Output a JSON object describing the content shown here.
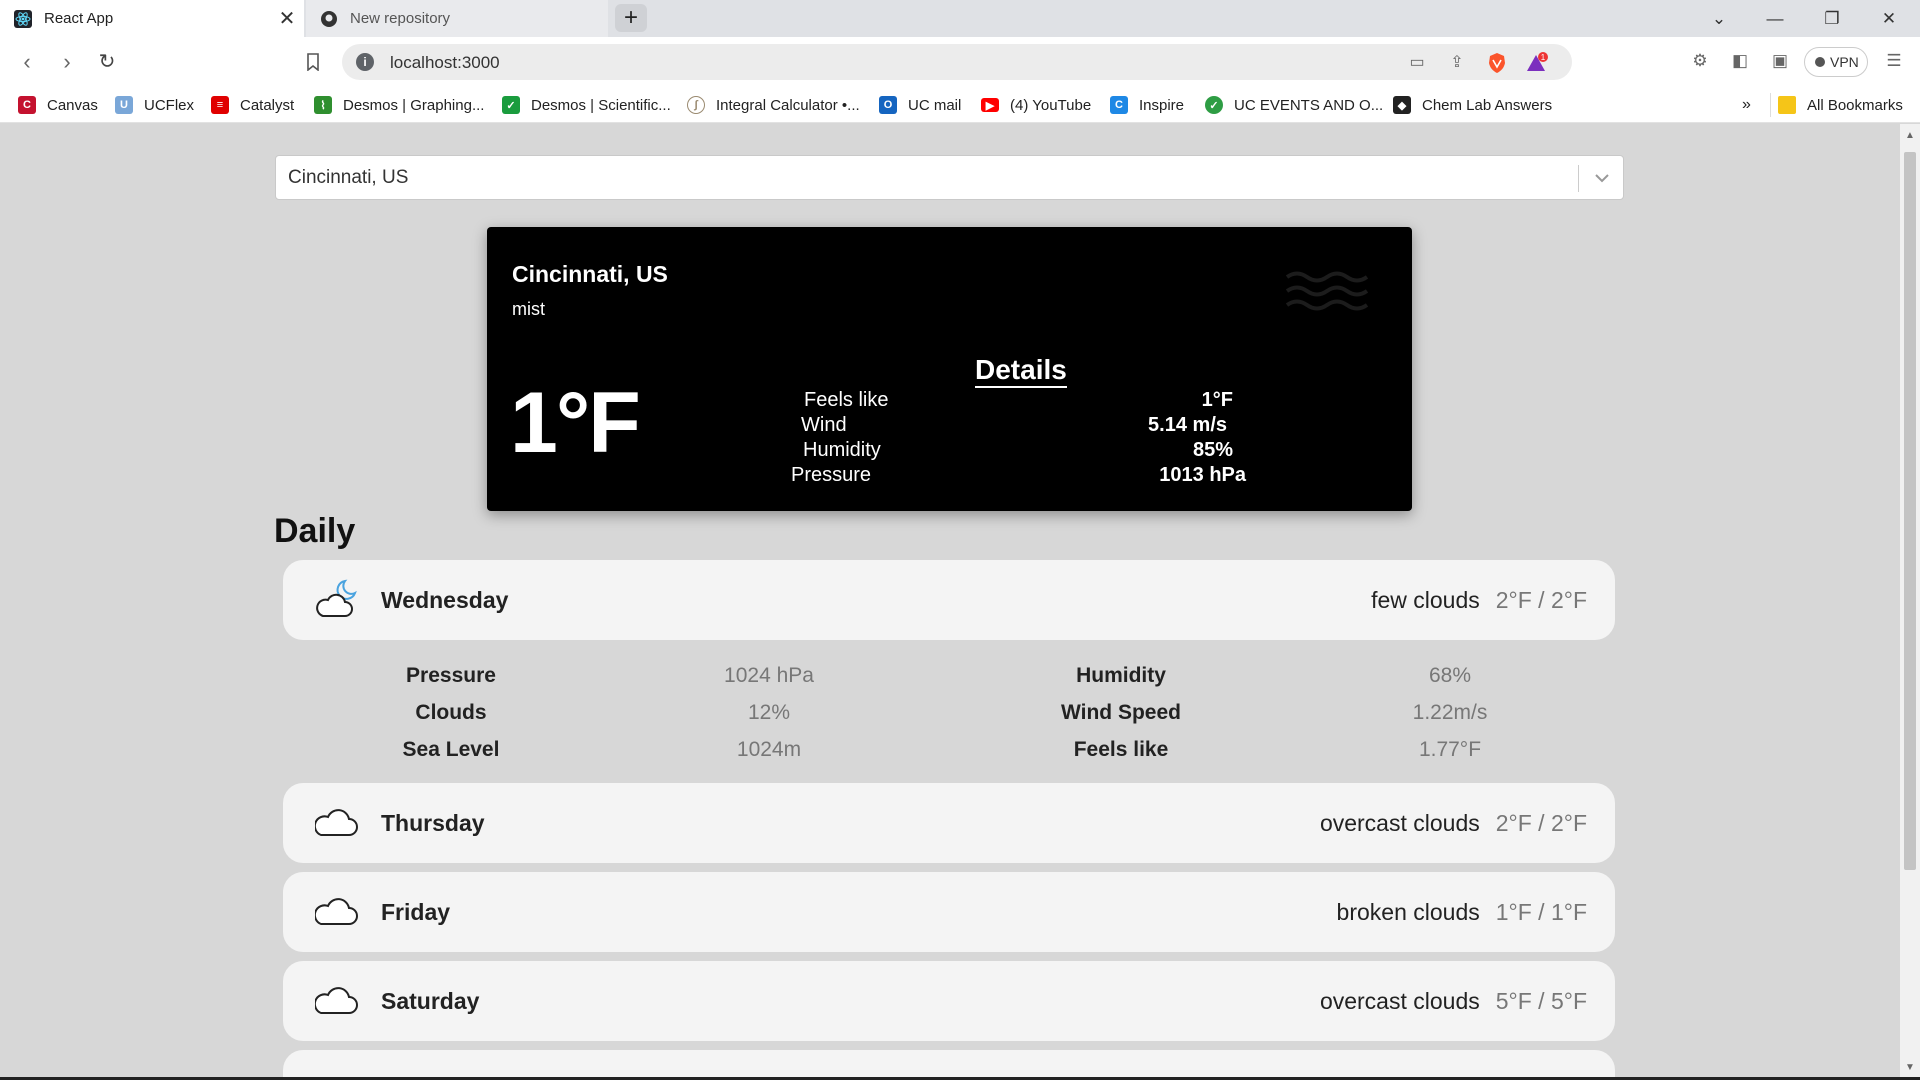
{
  "browser": {
    "tabs": [
      {
        "title": "React App",
        "active": true
      },
      {
        "title": "New repository",
        "active": false
      }
    ],
    "url": "localhost:3000",
    "vpn_label": "VPN",
    "brave_badge_count": "1",
    "bookmarks": [
      {
        "label": "Canvas",
        "color": "#c4122f"
      },
      {
        "label": "UCFlex",
        "color": "#7aa7d8"
      },
      {
        "label": "Catalyst",
        "color": "#e00000"
      },
      {
        "label": "Desmos | Graphing...",
        "color": "#2f8f2f"
      },
      {
        "label": "Desmos | Scientific...",
        "color": "#1a9c3e"
      },
      {
        "label": "Integral Calculator •...",
        "color": "#9a8a70"
      },
      {
        "label": "UC mail",
        "color": "#1565c0"
      },
      {
        "label": "(4) YouTube",
        "color": "#ff0000"
      },
      {
        "label": "Inspire",
        "color": "#1e88e5"
      },
      {
        "label": "UC EVENTS AND O...",
        "color": "#2e9d44"
      },
      {
        "label": "Chem Lab Answers",
        "color": "#222222"
      }
    ],
    "all_bookmarks_label": "All Bookmarks",
    "overflow_label": "»"
  },
  "search": {
    "value": "Cincinnati, US"
  },
  "current": {
    "city": "Cincinnati, US",
    "description": "mist",
    "temperature": "1°F",
    "details_title": "Details",
    "details": [
      {
        "label": "Feels like",
        "value": "1°F"
      },
      {
        "label": "Wind",
        "value": "5.14 m/s"
      },
      {
        "label": "Humidity",
        "value": "85%"
      },
      {
        "label": "Pressure",
        "value": "1013 hPa"
      }
    ]
  },
  "daily_title": "Daily",
  "days": [
    {
      "name": "Wednesday",
      "condition": "few clouds",
      "minmax": "2°F / 2°F",
      "icon": "moon-cloud-icon"
    },
    {
      "name": "Thursday",
      "condition": "overcast clouds",
      "minmax": "2°F / 2°F",
      "icon": "cloud-icon"
    },
    {
      "name": "Friday",
      "condition": "broken clouds",
      "minmax": "1°F / 1°F",
      "icon": "cloud-icon"
    },
    {
      "name": "Saturday",
      "condition": "overcast clouds",
      "minmax": "5°F / 5°F",
      "icon": "cloud-icon"
    }
  ],
  "expanded_details": {
    "left": [
      {
        "label": "Pressure",
        "value": "1024 hPa"
      },
      {
        "label": "Clouds",
        "value": "12%"
      },
      {
        "label": "Sea Level",
        "value": "1024m"
      }
    ],
    "right": [
      {
        "label": "Humidity",
        "value": "68%"
      },
      {
        "label": "Wind Speed",
        "value": "1.22m/s"
      },
      {
        "label": "Feels like",
        "value": "1.77°F"
      }
    ]
  }
}
